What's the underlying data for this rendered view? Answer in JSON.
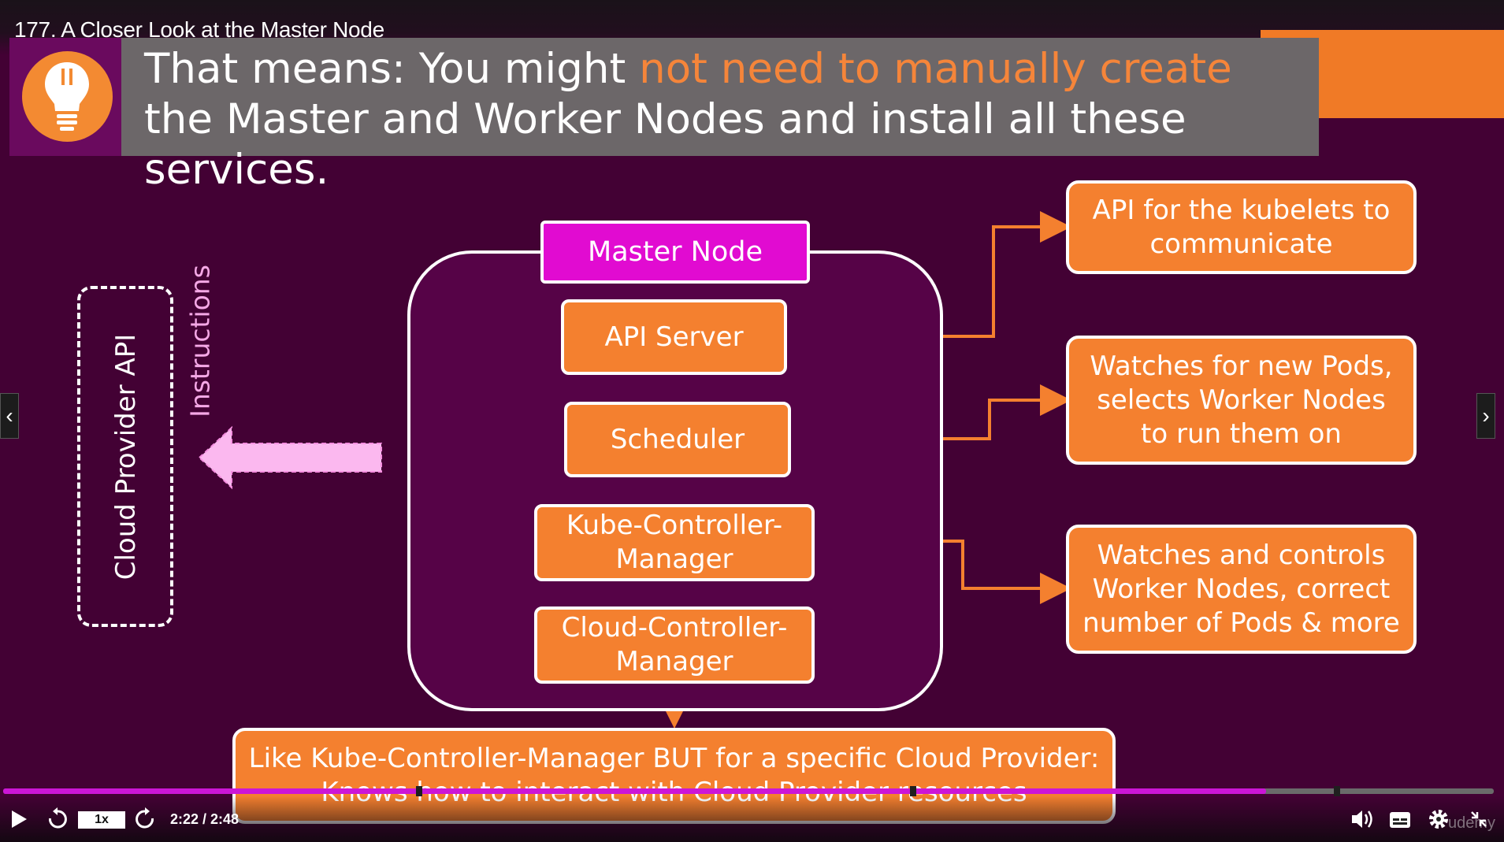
{
  "lecture": {
    "title": "177. A Closer Look at the Master Node"
  },
  "banner": {
    "part1": "That means: You might ",
    "highlight": "not need to manually create",
    "part2": " the Master and Worker Nodes and install all these services."
  },
  "diagram": {
    "master_node": "Master Node",
    "components": {
      "api_server": "API Server",
      "scheduler": "Scheduler",
      "kcm_line1": "Kube-Controller-",
      "kcm_line2": "Manager",
      "ccm_line1": "Cloud-Controller-",
      "ccm_line2": "Manager"
    },
    "descriptions": {
      "api_server": "API for the kubelets to communicate",
      "scheduler": "Watches for new Pods, selects Worker Nodes to run them on",
      "kcm": "Watches and controls Worker Nodes, correct number of Pods & more",
      "ccm_line1": "Like Kube-Controller-Manager BUT for a specific Cloud Provider:",
      "ccm_line2": "Knows how to interact with Cloud Provider resources"
    },
    "cloud_provider_api": "Cloud Provider API",
    "instructions": "Instructions"
  },
  "player": {
    "speed": "1x",
    "time": "2:22 / 2:48",
    "progress_fraction": 0.847,
    "watermark": "udemy"
  },
  "colors": {
    "background": "#430134",
    "orange": "#f4802f",
    "magenta": "#e10bd1",
    "progress": "#cc16d6"
  }
}
